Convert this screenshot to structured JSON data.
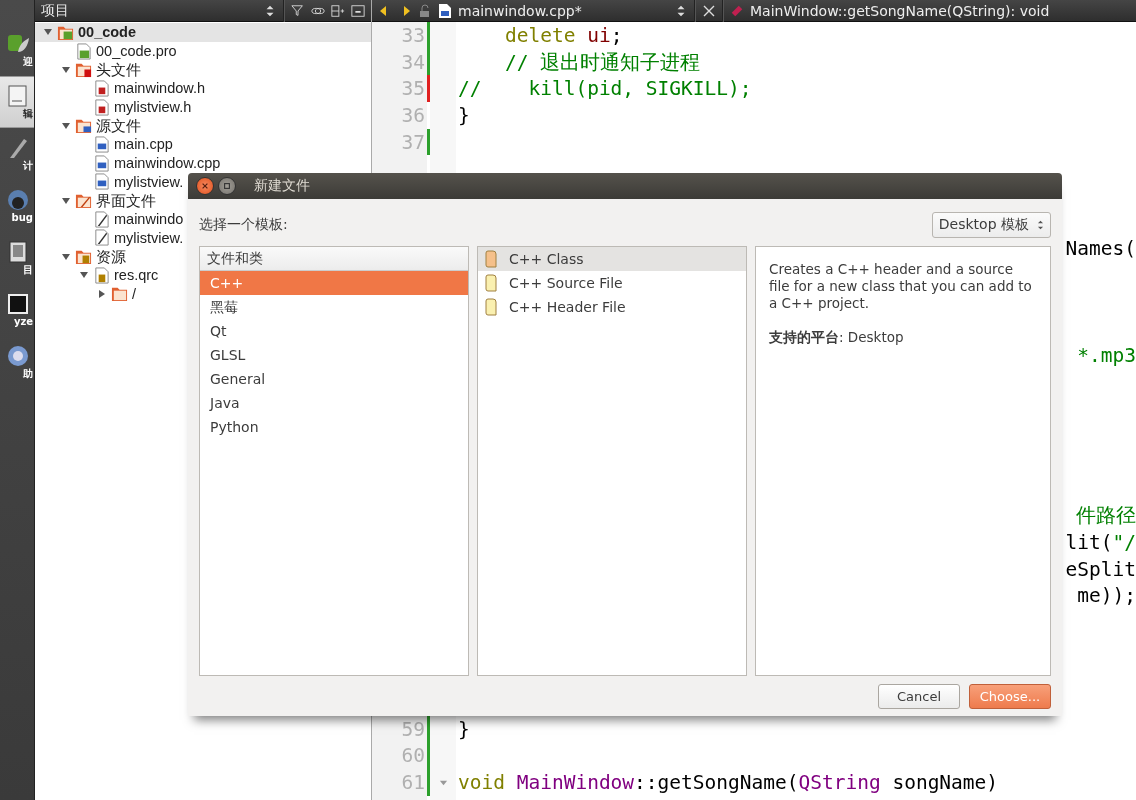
{
  "mode_bar": [
    {
      "kind": "welcome",
      "label": "迎",
      "selected": false
    },
    {
      "kind": "edit",
      "label": "辑",
      "selected": true
    },
    {
      "kind": "design",
      "label": "计",
      "selected": false
    },
    {
      "kind": "debug",
      "label": "bug",
      "selected": false
    },
    {
      "kind": "projects",
      "label": "目",
      "selected": false
    },
    {
      "kind": "analyze",
      "label": "yze",
      "selected": false
    },
    {
      "kind": "help",
      "label": "助",
      "selected": false
    }
  ],
  "project_panel": {
    "title": "项目",
    "tree": [
      {
        "kind": "project",
        "label": "00_code",
        "selected": true,
        "expanded": true,
        "children": [
          {
            "kind": "pro",
            "label": "00_code.pro",
            "selected": false
          },
          {
            "kind": "folder-h",
            "label": "头文件",
            "selected": false,
            "expanded": true,
            "children": [
              {
                "kind": "h",
                "label": "mainwindow.h",
                "selected": false
              },
              {
                "kind": "h",
                "label": "mylistview.h",
                "selected": false
              }
            ]
          },
          {
            "kind": "folder-cpp",
            "label": "源文件",
            "selected": false,
            "expanded": true,
            "children": [
              {
                "kind": "cpp",
                "label": "main.cpp",
                "selected": false
              },
              {
                "kind": "cpp",
                "label": "mainwindow.cpp",
                "selected": false
              },
              {
                "kind": "cpp",
                "label": "mylistview.",
                "selected": false
              }
            ]
          },
          {
            "kind": "folder-ui",
            "label": "界面文件",
            "selected": false,
            "expanded": true,
            "children": [
              {
                "kind": "ui",
                "label": "mainwindo",
                "selected": false
              },
              {
                "kind": "ui",
                "label": "mylistview.",
                "selected": false
              }
            ]
          },
          {
            "kind": "folder-res",
            "label": "资源",
            "selected": false,
            "expanded": true,
            "children": [
              {
                "kind": "qrc",
                "label": "res.qrc",
                "selected": false,
                "expanded": true,
                "children": [
                  {
                    "kind": "folder",
                    "label": "/",
                    "selected": false,
                    "expanded": false
                  }
                ]
              }
            ]
          }
        ]
      }
    ]
  },
  "editor": {
    "file_name": "mainwindow.cpp*",
    "symbol": "MainWindow::getSongName(QString): void",
    "lines": [
      {
        "number": "33",
        "unsaved": false,
        "segments": [
          {
            "kind": "keyword",
            "text": "    delete "
          },
          {
            "kind": "member",
            "text": "ui"
          },
          {
            "kind": "plain",
            "text": ";"
          }
        ]
      },
      {
        "number": "34",
        "unsaved": false,
        "segments": [
          {
            "kind": "comment",
            "text": "    // 退出时通知子进程"
          }
        ]
      },
      {
        "number": "35",
        "unsaved": true,
        "segments": [
          {
            "kind": "comment",
            "text": "//    kill(pid, SIGKILL);"
          }
        ]
      },
      {
        "number": "36",
        "segments": [
          {
            "kind": "plain",
            "text": "}"
          }
        ]
      },
      {
        "number": "37",
        "unsaved": false
      },
      {
        "number": "59",
        "unsaved": false,
        "segments": [
          {
            "kind": "plain",
            "text": "}"
          }
        ]
      },
      {
        "number": "60",
        "unsaved": false
      },
      {
        "number": "61",
        "unsaved": false,
        "foldable": true,
        "segments": [
          {
            "kind": "keyword",
            "text": "void "
          },
          {
            "kind": "type",
            "text": "MainWindow"
          },
          {
            "kind": "plain",
            "text": "::getSongName("
          },
          {
            "kind": "type",
            "text": "QString"
          },
          {
            "kind": "plain",
            "text": " songName)"
          }
        ]
      }
    ],
    "fragments": [
      {
        "segments": [
          {
            "kind": "plain",
            "text": "Names("
          }
        ]
      },
      {
        "segments": [
          {
            "kind": "comment",
            "text": "*.mp3"
          }
        ]
      },
      {
        "segments": [
          {
            "kind": "comment",
            "text": "件路径"
          }
        ]
      },
      {
        "segments": [
          {
            "kind": "plain",
            "text": "lit("
          },
          {
            "kind": "comment",
            "text": "\"/"
          }
        ]
      },
      {
        "segments": [
          {
            "kind": "plain",
            "text": "eSplit"
          }
        ]
      },
      {
        "segments": [
          {
            "kind": "plain",
            "text": "me));"
          }
        ]
      }
    ]
  },
  "dialog": {
    "title": "新建文件",
    "prompt": "选择一个模板:",
    "filter": "Desktop 模板",
    "categories": {
      "header": "文件和类",
      "items": [
        {
          "label": "C++",
          "selected": true
        },
        {
          "label": "黑莓",
          "selected": false
        },
        {
          "label": "Qt",
          "selected": false
        },
        {
          "label": "GLSL",
          "selected": false
        },
        {
          "label": "General",
          "selected": false
        },
        {
          "label": "Java",
          "selected": false
        },
        {
          "label": "Python",
          "selected": false
        }
      ]
    },
    "templates": [
      {
        "label": "C++ Class",
        "selected": true
      },
      {
        "label": "C++ Source File",
        "selected": false
      },
      {
        "label": "C++ Header File",
        "selected": false
      }
    ],
    "description": "Creates a C++ header and a source file for a new class that you can add to a C++ project.",
    "platform": "**支持的平台**: Desktop",
    "buttons": [
      {
        "label": "Cancel",
        "kind": "normal"
      },
      {
        "label": "Choose...",
        "kind": "default"
      }
    ]
  }
}
